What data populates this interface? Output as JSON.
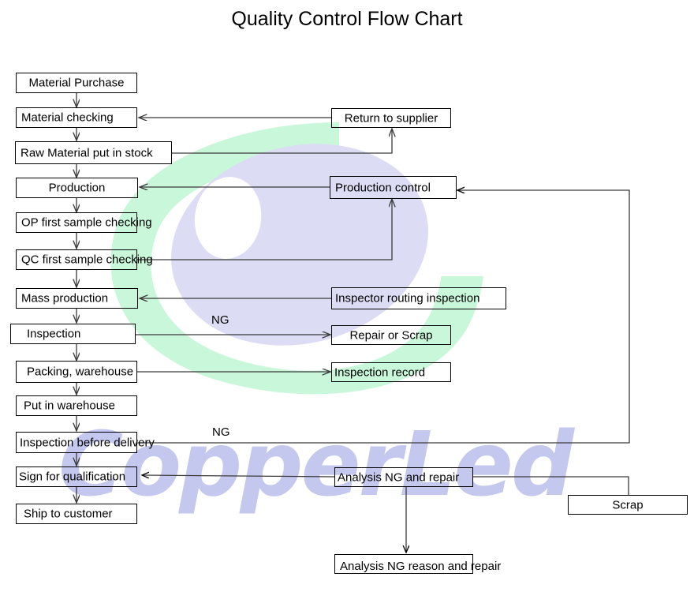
{
  "title": "Quality Control Flow Chart",
  "watermark": {
    "text": "CopperLed",
    "text_color": "#c5c8ee",
    "ellipse_color": "#dcdcf4",
    "swoosh_color": "#c9f7da"
  },
  "colors": {
    "line": "#3a3a3a",
    "box_border": "#000000",
    "text": "#000000",
    "background": "#ffffff"
  },
  "nodes": {
    "material_purchase": {
      "label": "Material Purchase"
    },
    "material_checking": {
      "label": "Material checking"
    },
    "raw_material_stock": {
      "label": "Raw Material put in stock"
    },
    "production": {
      "label": "Production"
    },
    "op_first_sample": {
      "label": "OP first sample checking"
    },
    "qc_first_sample": {
      "label": "QC first sample checking"
    },
    "mass_production": {
      "label": "Mass production"
    },
    "inspection": {
      "label": "Inspection"
    },
    "packing_warehouse": {
      "label": "Packing, warehouse"
    },
    "put_in_warehouse": {
      "label": "Put in warehouse"
    },
    "inspection_before_delivery": {
      "label": "Inspection before delivery"
    },
    "sign_for_qualification": {
      "label": "Sign for qualification"
    },
    "ship_to_customer": {
      "label": "Ship to customer"
    },
    "return_to_supplier": {
      "label": "Return to supplier"
    },
    "production_control": {
      "label": "Production control"
    },
    "inspector_routing_inspection": {
      "label": "Inspector routing inspection"
    },
    "repair_or_scrap": {
      "label": "Repair or Scrap"
    },
    "inspection_record": {
      "label": "Inspection record"
    },
    "analysis_ng_and_repair": {
      "label": "Analysis NG and repair"
    },
    "analysis_ng_reason_and_repair": {
      "label": "Analysis NG reason and repair"
    },
    "scrap": {
      "label": "Scrap"
    }
  },
  "edge_labels": {
    "ng_inspection": "NG",
    "ng_before_delivery": "NG"
  },
  "chart_data": {
    "type": "diagram",
    "title": "Quality Control Flow Chart",
    "nodes": [
      "Material Purchase",
      "Material checking",
      "Raw Material put in stock",
      "Production",
      "OP first sample checking",
      "QC first sample checking",
      "Mass production",
      "Inspection",
      "Packing, warehouse",
      "Put in warehouse",
      "Inspection before delivery",
      "Sign for qualification",
      "Ship to customer",
      "Return to supplier",
      "Production control",
      "Inspector routing inspection",
      "Repair or Scrap",
      "Inspection record",
      "Analysis NG and repair",
      "Analysis NG reason and repair",
      "Scrap"
    ],
    "edges": [
      {
        "from": "Material Purchase",
        "to": "Material checking",
        "label": ""
      },
      {
        "from": "Material checking",
        "to": "Raw Material put in stock",
        "label": ""
      },
      {
        "from": "Raw Material put in stock",
        "to": "Return to supplier",
        "label": ""
      },
      {
        "from": "Return to supplier",
        "to": "Material checking",
        "label": ""
      },
      {
        "from": "Raw Material put in stock",
        "to": "Production",
        "label": ""
      },
      {
        "from": "Production control",
        "to": "Production",
        "label": ""
      },
      {
        "from": "Production",
        "to": "OP first sample checking",
        "label": ""
      },
      {
        "from": "OP first sample checking",
        "to": "QC first sample checking",
        "label": ""
      },
      {
        "from": "QC first sample checking",
        "to": "Production control",
        "label": ""
      },
      {
        "from": "QC first sample checking",
        "to": "Mass production",
        "label": ""
      },
      {
        "from": "Inspector routing inspection",
        "to": "Mass production",
        "label": ""
      },
      {
        "from": "Mass production",
        "to": "Inspection",
        "label": ""
      },
      {
        "from": "Inspection",
        "to": "Repair or Scrap",
        "label": "NG"
      },
      {
        "from": "Inspection",
        "to": "Packing, warehouse",
        "label": ""
      },
      {
        "from": "Packing, warehouse",
        "to": "Inspection record",
        "label": ""
      },
      {
        "from": "Packing, warehouse",
        "to": "Put in warehouse",
        "label": ""
      },
      {
        "from": "Put in warehouse",
        "to": "Inspection before delivery",
        "label": ""
      },
      {
        "from": "Inspection before delivery",
        "to": "Production control",
        "label": "NG"
      },
      {
        "from": "Inspection before delivery",
        "to": "Sign for qualification",
        "label": ""
      },
      {
        "from": "Analysis NG and repair",
        "to": "Sign for qualification",
        "label": ""
      },
      {
        "from": "Analysis NG and repair",
        "to": "Scrap",
        "label": ""
      },
      {
        "from": "Analysis NG and repair",
        "to": "Analysis NG reason and repair",
        "label": ""
      },
      {
        "from": "Sign for qualification",
        "to": "Ship to customer",
        "label": ""
      }
    ]
  }
}
